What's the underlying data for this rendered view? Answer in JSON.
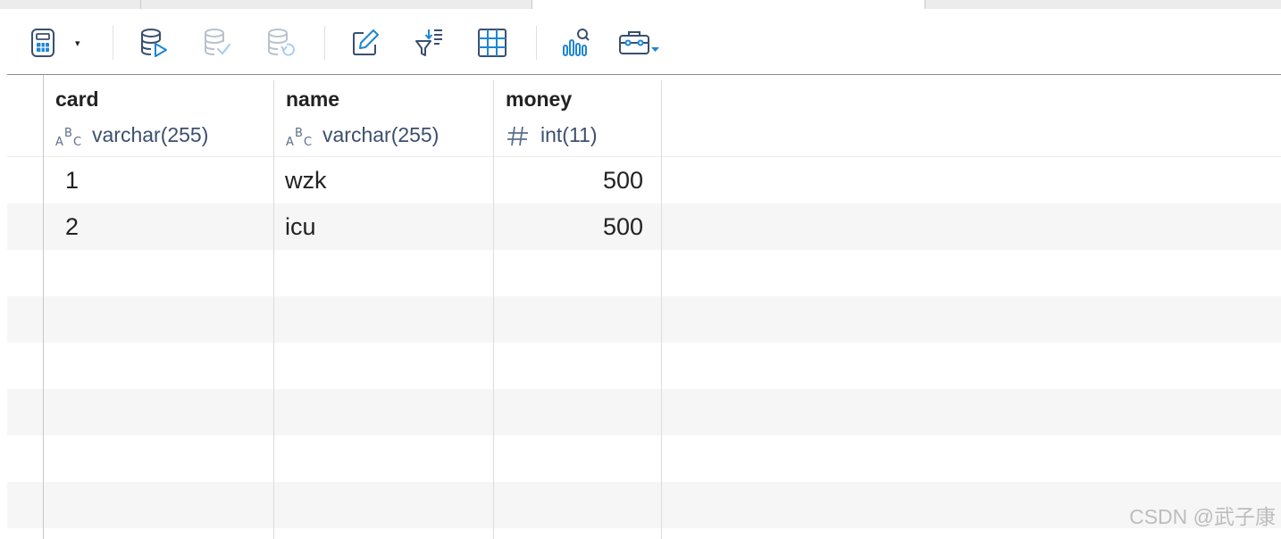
{
  "toolbar": {
    "buttons": [
      {
        "name": "calculator-icon",
        "enabled": true
      },
      {
        "name": "db-execute-icon",
        "enabled": true
      },
      {
        "name": "db-commit-icon",
        "enabled": false
      },
      {
        "name": "db-rollback-icon",
        "enabled": false
      },
      {
        "name": "edit-pencil-icon",
        "enabled": true
      },
      {
        "name": "filter-sort-icon",
        "enabled": true
      },
      {
        "name": "grid-view-icon",
        "enabled": true
      },
      {
        "name": "chart-search-icon",
        "enabled": true
      },
      {
        "name": "toolbox-icon",
        "enabled": true
      }
    ],
    "dropdown_caret": "▾",
    "accent_color": "#1d86d4"
  },
  "table": {
    "columns": [
      {
        "name": "card",
        "type": "varchar(255)",
        "type_icon": "abc-text-icon"
      },
      {
        "name": "name",
        "type": "varchar(255)",
        "type_icon": "abc-text-icon"
      },
      {
        "name": "money",
        "type": "int(11)",
        "type_icon": "hash-number-icon"
      }
    ],
    "rows": [
      {
        "card": "1",
        "name": "wzk",
        "money": "500"
      },
      {
        "card": "2",
        "name": "icu",
        "money": "500"
      }
    ]
  },
  "watermark": "CSDN @武子康"
}
